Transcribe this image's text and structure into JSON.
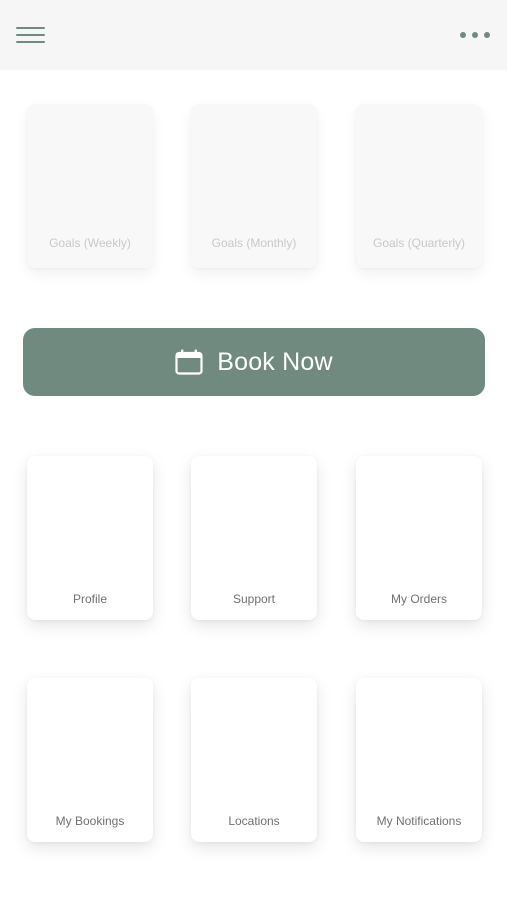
{
  "header": {
    "menu_icon": "hamburger-menu-icon",
    "more_icon": "more-horizontal-icon",
    "icon_color": "#708a80",
    "background": "#f6f6f6"
  },
  "goals": [
    {
      "label": "Goals (Weekly)"
    },
    {
      "label": "Goals (Monthly)"
    },
    {
      "label": "Goals (Quarterly)"
    }
  ],
  "book_button": {
    "label": "Book Now",
    "icon": "calendar-icon",
    "color": "#708a7f"
  },
  "menu_tiles": [
    {
      "label": "Profile"
    },
    {
      "label": "Support"
    },
    {
      "label": "My Orders"
    },
    {
      "label": "My Bookings"
    },
    {
      "label": "Locations"
    },
    {
      "label": "My Notifications"
    }
  ]
}
